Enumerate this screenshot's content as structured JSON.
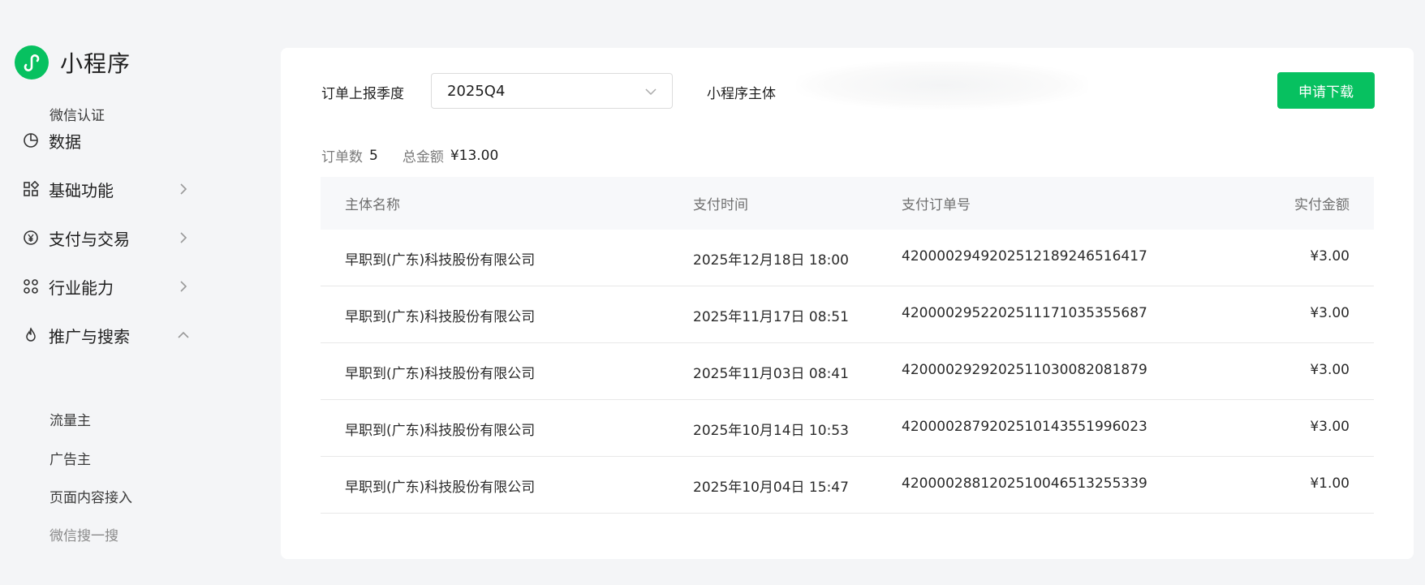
{
  "app": {
    "name": "小程序"
  },
  "sidebar": {
    "top_sub": "微信认证",
    "items": [
      {
        "label": "数据",
        "icon": "pie-chart-icon"
      },
      {
        "label": "基础功能",
        "icon": "grid-apps-icon"
      },
      {
        "label": "支付与交易",
        "icon": "yuan-circle-icon"
      },
      {
        "label": "行业能力",
        "icon": "industry-nodes-icon"
      },
      {
        "label": "推广与搜索",
        "icon": "flame-icon"
      }
    ],
    "promo_sub": [
      "流量主",
      "广告主",
      "页面内容接入",
      "微信搜一搜"
    ]
  },
  "filters": {
    "quarter_label": "订单上报季度",
    "quarter_value": "2025Q4",
    "owner_label": "小程序主体",
    "download_button": "申请下载"
  },
  "summary": {
    "order_count_label": "订单数",
    "order_count": "5",
    "total_label": "总金额",
    "total": "¥13.00"
  },
  "table": {
    "columns": [
      "主体名称",
      "支付时间",
      "支付订单号",
      "实付金额"
    ],
    "rows": [
      [
        "早职到(广东)科技股份有限公司",
        "2025年12月18日 18:00",
        "4200002949202512189246516417",
        "¥3.00"
      ],
      [
        "早职到(广东)科技股份有限公司",
        "2025年11月17日 08:51",
        "4200002952202511171035355687",
        "¥3.00"
      ],
      [
        "早职到(广东)科技股份有限公司",
        "2025年11月03日 08:41",
        "4200002929202511030082081879",
        "¥3.00"
      ],
      [
        "早职到(广东)科技股份有限公司",
        "2025年10月14日 10:53",
        "4200002879202510143551996023",
        "¥3.00"
      ],
      [
        "早职到(广东)科技股份有限公司",
        "2025年10月04日 15:47",
        "4200002881202510046513255339",
        "¥1.00"
      ]
    ]
  },
  "colors": {
    "accent": "#07c160",
    "page_bg": "#f4f5f7"
  }
}
